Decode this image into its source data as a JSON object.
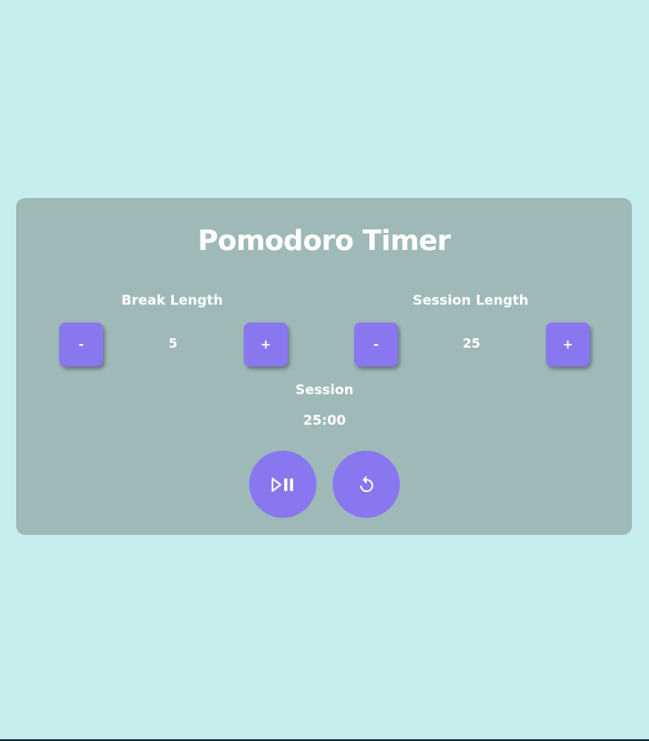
{
  "app": {
    "title": "Pomodoro Timer"
  },
  "break": {
    "label": "Break Length",
    "value": "5",
    "decrement_label": "-",
    "increment_label": "+"
  },
  "session": {
    "label": "Session Length",
    "value": "25",
    "decrement_label": "-",
    "increment_label": "+"
  },
  "timer": {
    "label": "Session",
    "time": "25:00"
  },
  "controls": {
    "play_pause_icon": "play-pause-icon",
    "reset_icon": "reset-icon"
  },
  "colors": {
    "background": "#c7eeee",
    "card": "#9fb9b9",
    "accent": "#8877ee",
    "text": "#ffffff"
  }
}
